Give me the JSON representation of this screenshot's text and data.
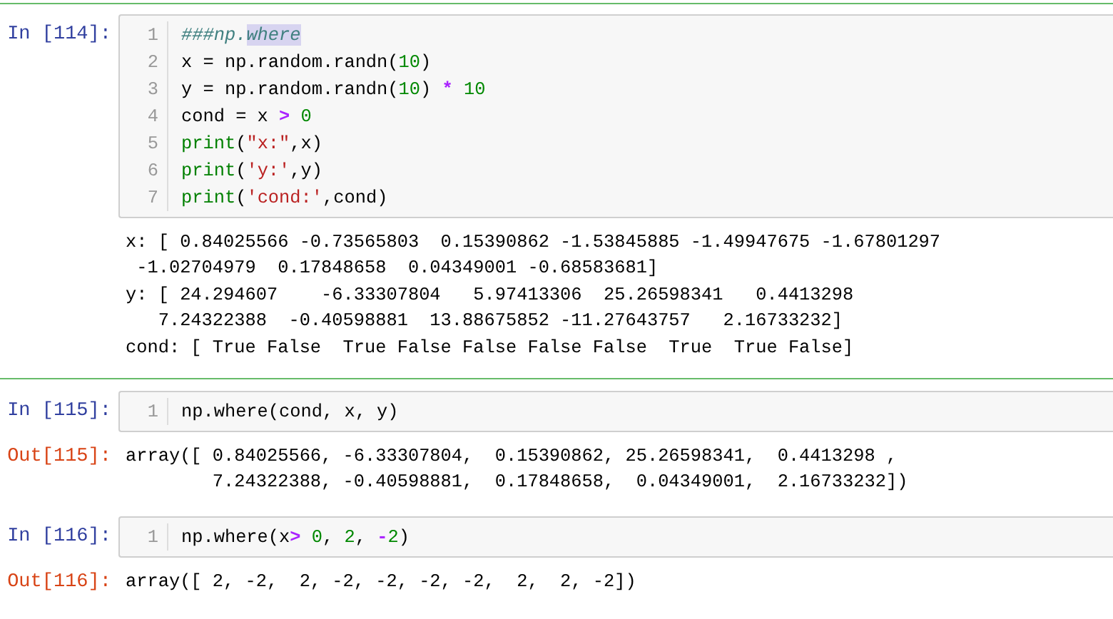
{
  "cells": [
    {
      "prompt": "In [114]:",
      "selected": true,
      "lines": [
        [
          {
            "kind": "comment",
            "text": "###np."
          },
          {
            "kind": "comment-selected",
            "text": "where"
          }
        ],
        [
          {
            "kind": "plain",
            "text": "x = np.random.randn("
          },
          {
            "kind": "number",
            "text": "10"
          },
          {
            "kind": "plain",
            "text": ")"
          }
        ],
        [
          {
            "kind": "plain",
            "text": "y = np.random.randn("
          },
          {
            "kind": "number",
            "text": "10"
          },
          {
            "kind": "plain",
            "text": ") "
          },
          {
            "kind": "operator",
            "text": "*"
          },
          {
            "kind": "number",
            "text": " 10"
          }
        ],
        [
          {
            "kind": "plain",
            "text": "cond = x "
          },
          {
            "kind": "operator",
            "text": ">"
          },
          {
            "kind": "number",
            "text": " 0"
          }
        ],
        [
          {
            "kind": "builtin",
            "text": "print"
          },
          {
            "kind": "plain",
            "text": "("
          },
          {
            "kind": "string",
            "text": "\"x:\""
          },
          {
            "kind": "plain",
            "text": ",x)"
          }
        ],
        [
          {
            "kind": "builtin",
            "text": "print"
          },
          {
            "kind": "plain",
            "text": "("
          },
          {
            "kind": "string",
            "text": "'y:'"
          },
          {
            "kind": "plain",
            "text": ",y)"
          }
        ],
        [
          {
            "kind": "builtin",
            "text": "print"
          },
          {
            "kind": "plain",
            "text": "("
          },
          {
            "kind": "string",
            "text": "'cond:'"
          },
          {
            "kind": "plain",
            "text": ",cond)"
          }
        ]
      ],
      "line_numbers": [
        "1",
        "2",
        "3",
        "4",
        "5",
        "6",
        "7"
      ],
      "output": {
        "kind": "stream",
        "lines": [
          "x: [ 0.84025566 -0.73565803  0.15390862 -1.53845885 -1.49947675 -1.67801297",
          " -1.02704979  0.17848658  0.04349001 -0.68583681]",
          "y: [ 24.294607    -6.33307804   5.97413306  25.26598341   0.4413298",
          "   7.24322388  -0.40598881  13.88675852 -11.27643757   2.16733232]",
          "cond: [ True False  True False False False False  True  True False]"
        ]
      }
    },
    {
      "prompt": "In [115]:",
      "selected": false,
      "lines": [
        [
          {
            "kind": "plain",
            "text": "np.where(cond, x, y)"
          }
        ]
      ],
      "line_numbers": [
        "1"
      ],
      "output": {
        "kind": "result",
        "prompt": "Out[115]:",
        "lines": [
          "array([ 0.84025566, -6.33307804,  0.15390862, 25.26598341,  0.4413298 ,",
          "        7.24322388, -0.40598881,  0.17848658,  0.04349001,  2.16733232])"
        ]
      }
    },
    {
      "prompt": "In [116]:",
      "selected": false,
      "lines": [
        [
          {
            "kind": "plain",
            "text": "np.where(x"
          },
          {
            "kind": "operator",
            "text": ">"
          },
          {
            "kind": "number",
            "text": " 0"
          },
          {
            "kind": "plain",
            "text": ", "
          },
          {
            "kind": "number",
            "text": "2"
          },
          {
            "kind": "plain",
            "text": ", "
          },
          {
            "kind": "operator",
            "text": "-"
          },
          {
            "kind": "number",
            "text": "2"
          },
          {
            "kind": "plain",
            "text": ")"
          }
        ]
      ],
      "line_numbers": [
        "1"
      ],
      "output": {
        "kind": "result",
        "prompt": "Out[116]:",
        "lines": [
          "array([ 2, -2,  2, -2, -2, -2, -2,  2,  2, -2])"
        ]
      }
    }
  ]
}
